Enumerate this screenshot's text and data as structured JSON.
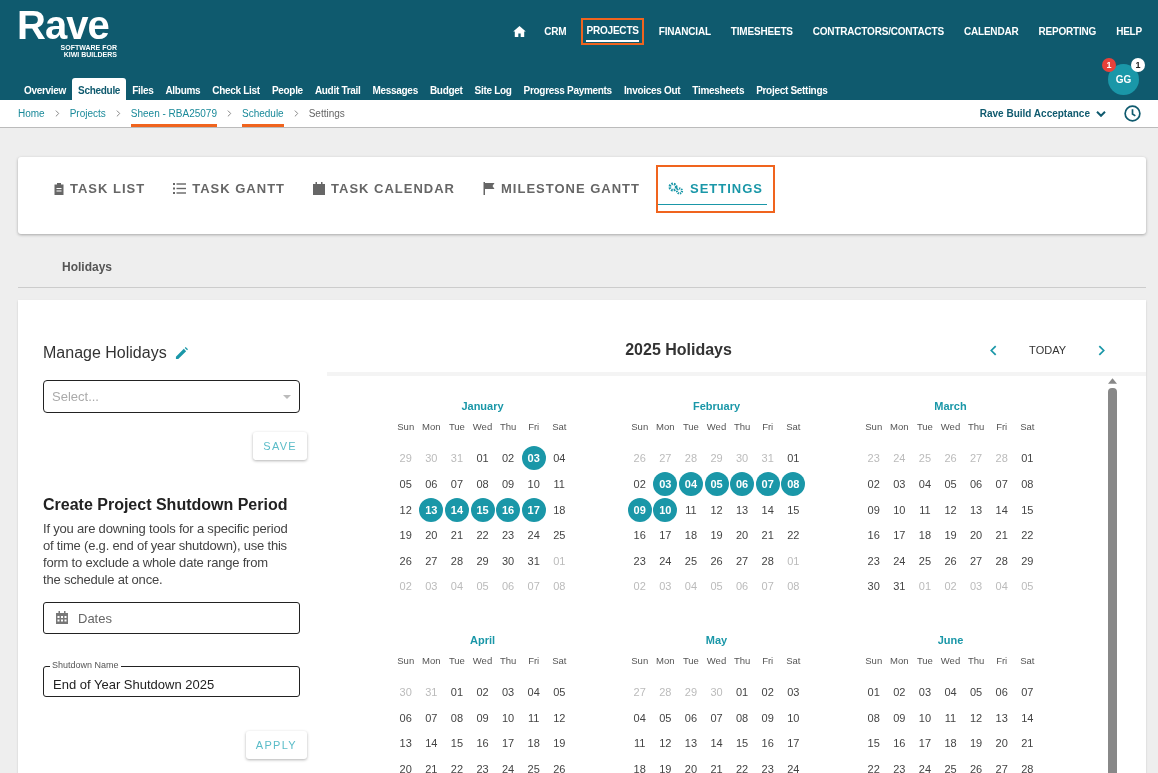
{
  "logo": {
    "name": "Rave",
    "tagline_lines": [
      "SOFTWARE FOR",
      "KIWI BUILDERS"
    ]
  },
  "main_nav": [
    {
      "label": "CRM",
      "selected": false,
      "highlighted": false
    },
    {
      "label": "PROJECTS",
      "selected": true,
      "highlighted": true
    },
    {
      "label": "FINANCIAL",
      "selected": false,
      "highlighted": false
    },
    {
      "label": "TIMESHEETS",
      "selected": false,
      "highlighted": false
    },
    {
      "label": "CONTRACTORS/CONTACTS",
      "selected": false,
      "highlighted": false
    },
    {
      "label": "CALENDAR",
      "selected": false,
      "highlighted": false
    },
    {
      "label": "REPORTING",
      "selected": false,
      "highlighted": false
    },
    {
      "label": "HELP",
      "selected": false,
      "highlighted": false
    }
  ],
  "project_nav": [
    {
      "label": "Overview",
      "selected": false
    },
    {
      "label": "Schedule",
      "selected": true
    },
    {
      "label": "Files",
      "selected": false
    },
    {
      "label": "Albums",
      "selected": false
    },
    {
      "label": "Check List",
      "selected": false
    },
    {
      "label": "People",
      "selected": false
    },
    {
      "label": "Audit Trail",
      "selected": false
    },
    {
      "label": "Messages",
      "selected": false
    },
    {
      "label": "Budget",
      "selected": false
    },
    {
      "label": "Site Log",
      "selected": false
    },
    {
      "label": "Progress Payments",
      "selected": false
    },
    {
      "label": "Invoices Out",
      "selected": false
    },
    {
      "label": "Timesheets",
      "selected": false
    },
    {
      "label": "Project Settings",
      "selected": false
    }
  ],
  "user": {
    "initials": "GG",
    "alert_count": "1",
    "message_count": "1"
  },
  "breadcrumbs": [
    {
      "label": "Home",
      "current": false,
      "highlighted": false
    },
    {
      "label": "Projects",
      "current": false,
      "highlighted": false
    },
    {
      "label": "Sheen - RBA25079",
      "current": false,
      "highlighted": true
    },
    {
      "label": "Schedule",
      "current": false,
      "highlighted": true
    },
    {
      "label": "Settings",
      "current": true,
      "highlighted": false
    }
  ],
  "company": "Rave Build Acceptance",
  "schedule_tabs": [
    {
      "label": "TASK LIST",
      "selected": false,
      "highlighted": false
    },
    {
      "label": "TASK GANTT",
      "selected": false,
      "highlighted": false
    },
    {
      "label": "TASK CALENDAR",
      "selected": false,
      "highlighted": false
    },
    {
      "label": "MILESTONE GANTT",
      "selected": false,
      "highlighted": false
    },
    {
      "label": "SETTINGS",
      "selected": true,
      "highlighted": true
    }
  ],
  "section_tab": "Holidays",
  "manage": {
    "title": "Manage Holidays",
    "select_placeholder": "Select...",
    "save": "SAVE"
  },
  "shutdown": {
    "title": "Create Project Shutdown Period",
    "description": "If you are downing tools for a specific period of time (e.g. end of year shutdown), use this form to exclude a whole date range from the schedule at once.",
    "dates_placeholder": "Dates",
    "name_label": "Shutdown Name",
    "name_value": "End of Year Shutdown 2025",
    "apply": "APPLY"
  },
  "calendar": {
    "title": "2025 Holidays",
    "today": "TODAY",
    "months": [
      {
        "name": "January",
        "weekdays": [
          "Sun",
          "Mon",
          "Tue",
          "Wed",
          "Thu",
          "Fri",
          "Sat"
        ],
        "weeks": [
          [
            {
              "day": "29",
              "outside": true,
              "holiday": false
            },
            {
              "day": "30",
              "outside": true,
              "holiday": false
            },
            {
              "day": "31",
              "outside": true,
              "holiday": false
            },
            {
              "day": "01",
              "outside": false,
              "holiday": false
            },
            {
              "day": "02",
              "outside": false,
              "holiday": false
            },
            {
              "day": "03",
              "outside": false,
              "holiday": true
            },
            {
              "day": "04",
              "outside": false,
              "holiday": false
            }
          ],
          [
            {
              "day": "05",
              "outside": false,
              "holiday": false
            },
            {
              "day": "06",
              "outside": false,
              "holiday": false
            },
            {
              "day": "07",
              "outside": false,
              "holiday": false
            },
            {
              "day": "08",
              "outside": false,
              "holiday": false
            },
            {
              "day": "09",
              "outside": false,
              "holiday": false
            },
            {
              "day": "10",
              "outside": false,
              "holiday": false
            },
            {
              "day": "11",
              "outside": false,
              "holiday": false
            }
          ],
          [
            {
              "day": "12",
              "outside": false,
              "holiday": false
            },
            {
              "day": "13",
              "outside": false,
              "holiday": true
            },
            {
              "day": "14",
              "outside": false,
              "holiday": true
            },
            {
              "day": "15",
              "outside": false,
              "holiday": true
            },
            {
              "day": "16",
              "outside": false,
              "holiday": true
            },
            {
              "day": "17",
              "outside": false,
              "holiday": true
            },
            {
              "day": "18",
              "outside": false,
              "holiday": false
            }
          ],
          [
            {
              "day": "19",
              "outside": false,
              "holiday": false
            },
            {
              "day": "20",
              "outside": false,
              "holiday": false
            },
            {
              "day": "21",
              "outside": false,
              "holiday": false
            },
            {
              "day": "22",
              "outside": false,
              "holiday": false
            },
            {
              "day": "23",
              "outside": false,
              "holiday": false
            },
            {
              "day": "24",
              "outside": false,
              "holiday": false
            },
            {
              "day": "25",
              "outside": false,
              "holiday": false
            }
          ],
          [
            {
              "day": "26",
              "outside": false,
              "holiday": false
            },
            {
              "day": "27",
              "outside": false,
              "holiday": false
            },
            {
              "day": "28",
              "outside": false,
              "holiday": false
            },
            {
              "day": "29",
              "outside": false,
              "holiday": false
            },
            {
              "day": "30",
              "outside": false,
              "holiday": false
            },
            {
              "day": "31",
              "outside": false,
              "holiday": false
            },
            {
              "day": "01",
              "outside": true,
              "holiday": false
            }
          ],
          [
            {
              "day": "02",
              "outside": true,
              "holiday": false
            },
            {
              "day": "03",
              "outside": true,
              "holiday": false
            },
            {
              "day": "04",
              "outside": true,
              "holiday": false
            },
            {
              "day": "05",
              "outside": true,
              "holiday": false
            },
            {
              "day": "06",
              "outside": true,
              "holiday": false
            },
            {
              "day": "07",
              "outside": true,
              "holiday": false
            },
            {
              "day": "08",
              "outside": true,
              "holiday": false
            }
          ]
        ]
      },
      {
        "name": "February",
        "weekdays": [
          "Sun",
          "Mon",
          "Tue",
          "Wed",
          "Thu",
          "Fri",
          "Sat"
        ],
        "weeks": [
          [
            {
              "day": "26",
              "outside": true,
              "holiday": false
            },
            {
              "day": "27",
              "outside": true,
              "holiday": false
            },
            {
              "day": "28",
              "outside": true,
              "holiday": false
            },
            {
              "day": "29",
              "outside": true,
              "holiday": false
            },
            {
              "day": "30",
              "outside": true,
              "holiday": false
            },
            {
              "day": "31",
              "outside": true,
              "holiday": false
            },
            {
              "day": "01",
              "outside": false,
              "holiday": false
            }
          ],
          [
            {
              "day": "02",
              "outside": false,
              "holiday": false
            },
            {
              "day": "03",
              "outside": false,
              "holiday": true
            },
            {
              "day": "04",
              "outside": false,
              "holiday": true
            },
            {
              "day": "05",
              "outside": false,
              "holiday": true
            },
            {
              "day": "06",
              "outside": false,
              "holiday": true
            },
            {
              "day": "07",
              "outside": false,
              "holiday": true
            },
            {
              "day": "08",
              "outside": false,
              "holiday": true
            }
          ],
          [
            {
              "day": "09",
              "outside": false,
              "holiday": true
            },
            {
              "day": "10",
              "outside": false,
              "holiday": true
            },
            {
              "day": "11",
              "outside": false,
              "holiday": false
            },
            {
              "day": "12",
              "outside": false,
              "holiday": false
            },
            {
              "day": "13",
              "outside": false,
              "holiday": false
            },
            {
              "day": "14",
              "outside": false,
              "holiday": false
            },
            {
              "day": "15",
              "outside": false,
              "holiday": false
            }
          ],
          [
            {
              "day": "16",
              "outside": false,
              "holiday": false
            },
            {
              "day": "17",
              "outside": false,
              "holiday": false
            },
            {
              "day": "18",
              "outside": false,
              "holiday": false
            },
            {
              "day": "19",
              "outside": false,
              "holiday": false
            },
            {
              "day": "20",
              "outside": false,
              "holiday": false
            },
            {
              "day": "21",
              "outside": false,
              "holiday": false
            },
            {
              "day": "22",
              "outside": false,
              "holiday": false
            }
          ],
          [
            {
              "day": "23",
              "outside": false,
              "holiday": false
            },
            {
              "day": "24",
              "outside": false,
              "holiday": false
            },
            {
              "day": "25",
              "outside": false,
              "holiday": false
            },
            {
              "day": "26",
              "outside": false,
              "holiday": false
            },
            {
              "day": "27",
              "outside": false,
              "holiday": false
            },
            {
              "day": "28",
              "outside": false,
              "holiday": false
            },
            {
              "day": "01",
              "outside": true,
              "holiday": false
            }
          ],
          [
            {
              "day": "02",
              "outside": true,
              "holiday": false
            },
            {
              "day": "03",
              "outside": true,
              "holiday": false
            },
            {
              "day": "04",
              "outside": true,
              "holiday": false
            },
            {
              "day": "05",
              "outside": true,
              "holiday": false
            },
            {
              "day": "06",
              "outside": true,
              "holiday": false
            },
            {
              "day": "07",
              "outside": true,
              "holiday": false
            },
            {
              "day": "08",
              "outside": true,
              "holiday": false
            }
          ]
        ]
      },
      {
        "name": "March",
        "weekdays": [
          "Sun",
          "Mon",
          "Tue",
          "Wed",
          "Thu",
          "Fri",
          "Sat"
        ],
        "weeks": [
          [
            {
              "day": "23",
              "outside": true,
              "holiday": false
            },
            {
              "day": "24",
              "outside": true,
              "holiday": false
            },
            {
              "day": "25",
              "outside": true,
              "holiday": false
            },
            {
              "day": "26",
              "outside": true,
              "holiday": false
            },
            {
              "day": "27",
              "outside": true,
              "holiday": false
            },
            {
              "day": "28",
              "outside": true,
              "holiday": false
            },
            {
              "day": "01",
              "outside": false,
              "holiday": false
            }
          ],
          [
            {
              "day": "02",
              "outside": false,
              "holiday": false
            },
            {
              "day": "03",
              "outside": false,
              "holiday": false
            },
            {
              "day": "04",
              "outside": false,
              "holiday": false
            },
            {
              "day": "05",
              "outside": false,
              "holiday": false
            },
            {
              "day": "06",
              "outside": false,
              "holiday": false
            },
            {
              "day": "07",
              "outside": false,
              "holiday": false
            },
            {
              "day": "08",
              "outside": false,
              "holiday": false
            }
          ],
          [
            {
              "day": "09",
              "outside": false,
              "holiday": false
            },
            {
              "day": "10",
              "outside": false,
              "holiday": false
            },
            {
              "day": "11",
              "outside": false,
              "holiday": false
            },
            {
              "day": "12",
              "outside": false,
              "holiday": false
            },
            {
              "day": "13",
              "outside": false,
              "holiday": false
            },
            {
              "day": "14",
              "outside": false,
              "holiday": false
            },
            {
              "day": "15",
              "outside": false,
              "holiday": false
            }
          ],
          [
            {
              "day": "16",
              "outside": false,
              "holiday": false
            },
            {
              "day": "17",
              "outside": false,
              "holiday": false
            },
            {
              "day": "18",
              "outside": false,
              "holiday": false
            },
            {
              "day": "19",
              "outside": false,
              "holiday": false
            },
            {
              "day": "20",
              "outside": false,
              "holiday": false
            },
            {
              "day": "21",
              "outside": false,
              "holiday": false
            },
            {
              "day": "22",
              "outside": false,
              "holiday": false
            }
          ],
          [
            {
              "day": "23",
              "outside": false,
              "holiday": false
            },
            {
              "day": "24",
              "outside": false,
              "holiday": false
            },
            {
              "day": "25",
              "outside": false,
              "holiday": false
            },
            {
              "day": "26",
              "outside": false,
              "holiday": false
            },
            {
              "day": "27",
              "outside": false,
              "holiday": false
            },
            {
              "day": "28",
              "outside": false,
              "holiday": false
            },
            {
              "day": "29",
              "outside": false,
              "holiday": false
            }
          ],
          [
            {
              "day": "30",
              "outside": false,
              "holiday": false
            },
            {
              "day": "31",
              "outside": false,
              "holiday": false
            },
            {
              "day": "01",
              "outside": true,
              "holiday": false
            },
            {
              "day": "02",
              "outside": true,
              "holiday": false
            },
            {
              "day": "03",
              "outside": true,
              "holiday": false
            },
            {
              "day": "04",
              "outside": true,
              "holiday": false
            },
            {
              "day": "05",
              "outside": true,
              "holiday": false
            }
          ]
        ]
      },
      {
        "name": "April",
        "weekdays": [
          "Sun",
          "Mon",
          "Tue",
          "Wed",
          "Thu",
          "Fri",
          "Sat"
        ],
        "weeks": [
          [
            {
              "day": "30",
              "outside": true,
              "holiday": false
            },
            {
              "day": "31",
              "outside": true,
              "holiday": false
            },
            {
              "day": "01",
              "outside": false,
              "holiday": false
            },
            {
              "day": "02",
              "outside": false,
              "holiday": false
            },
            {
              "day": "03",
              "outside": false,
              "holiday": false
            },
            {
              "day": "04",
              "outside": false,
              "holiday": false
            },
            {
              "day": "05",
              "outside": false,
              "holiday": false
            }
          ],
          [
            {
              "day": "06",
              "outside": false,
              "holiday": false
            },
            {
              "day": "07",
              "outside": false,
              "holiday": false
            },
            {
              "day": "08",
              "outside": false,
              "holiday": false
            },
            {
              "day": "09",
              "outside": false,
              "holiday": false
            },
            {
              "day": "10",
              "outside": false,
              "holiday": false
            },
            {
              "day": "11",
              "outside": false,
              "holiday": false
            },
            {
              "day": "12",
              "outside": false,
              "holiday": false
            }
          ],
          [
            {
              "day": "13",
              "outside": false,
              "holiday": false
            },
            {
              "day": "14",
              "outside": false,
              "holiday": false
            },
            {
              "day": "15",
              "outside": false,
              "holiday": false
            },
            {
              "day": "16",
              "outside": false,
              "holiday": false
            },
            {
              "day": "17",
              "outside": false,
              "holiday": false
            },
            {
              "day": "18",
              "outside": false,
              "holiday": false
            },
            {
              "day": "19",
              "outside": false,
              "holiday": false
            }
          ],
          [
            {
              "day": "20",
              "outside": false,
              "holiday": false
            },
            {
              "day": "21",
              "outside": false,
              "holiday": false
            },
            {
              "day": "22",
              "outside": false,
              "holiday": false
            },
            {
              "day": "23",
              "outside": false,
              "holiday": false
            },
            {
              "day": "24",
              "outside": false,
              "holiday": false
            },
            {
              "day": "25",
              "outside": false,
              "holiday": false
            },
            {
              "day": "26",
              "outside": false,
              "holiday": false
            }
          ]
        ]
      },
      {
        "name": "May",
        "weekdays": [
          "Sun",
          "Mon",
          "Tue",
          "Wed",
          "Thu",
          "Fri",
          "Sat"
        ],
        "weeks": [
          [
            {
              "day": "27",
              "outside": true,
              "holiday": false
            },
            {
              "day": "28",
              "outside": true,
              "holiday": false
            },
            {
              "day": "29",
              "outside": true,
              "holiday": false
            },
            {
              "day": "30",
              "outside": true,
              "holiday": false
            },
            {
              "day": "01",
              "outside": false,
              "holiday": false
            },
            {
              "day": "02",
              "outside": false,
              "holiday": false
            },
            {
              "day": "03",
              "outside": false,
              "holiday": false
            }
          ],
          [
            {
              "day": "04",
              "outside": false,
              "holiday": false
            },
            {
              "day": "05",
              "outside": false,
              "holiday": false
            },
            {
              "day": "06",
              "outside": false,
              "holiday": false
            },
            {
              "day": "07",
              "outside": false,
              "holiday": false
            },
            {
              "day": "08",
              "outside": false,
              "holiday": false
            },
            {
              "day": "09",
              "outside": false,
              "holiday": false
            },
            {
              "day": "10",
              "outside": false,
              "holiday": false
            }
          ],
          [
            {
              "day": "11",
              "outside": false,
              "holiday": false
            },
            {
              "day": "12",
              "outside": false,
              "holiday": false
            },
            {
              "day": "13",
              "outside": false,
              "holiday": false
            },
            {
              "day": "14",
              "outside": false,
              "holiday": false
            },
            {
              "day": "15",
              "outside": false,
              "holiday": false
            },
            {
              "day": "16",
              "outside": false,
              "holiday": false
            },
            {
              "day": "17",
              "outside": false,
              "holiday": false
            }
          ],
          [
            {
              "day": "18",
              "outside": false,
              "holiday": false
            },
            {
              "day": "19",
              "outside": false,
              "holiday": false
            },
            {
              "day": "20",
              "outside": false,
              "holiday": false
            },
            {
              "day": "21",
              "outside": false,
              "holiday": false
            },
            {
              "day": "22",
              "outside": false,
              "holiday": false
            },
            {
              "day": "23",
              "outside": false,
              "holiday": false
            },
            {
              "day": "24",
              "outside": false,
              "holiday": false
            }
          ]
        ]
      },
      {
        "name": "June",
        "weekdays": [
          "Sun",
          "Mon",
          "Tue",
          "Wed",
          "Thu",
          "Fri",
          "Sat"
        ],
        "weeks": [
          [
            {
              "day": "01",
              "outside": false,
              "holiday": false
            },
            {
              "day": "02",
              "outside": false,
              "holiday": false
            },
            {
              "day": "03",
              "outside": false,
              "holiday": false
            },
            {
              "day": "04",
              "outside": false,
              "holiday": false
            },
            {
              "day": "05",
              "outside": false,
              "holiday": false
            },
            {
              "day": "06",
              "outside": false,
              "holiday": false
            },
            {
              "day": "07",
              "outside": false,
              "holiday": false
            }
          ],
          [
            {
              "day": "08",
              "outside": false,
              "holiday": false
            },
            {
              "day": "09",
              "outside": false,
              "holiday": false
            },
            {
              "day": "10",
              "outside": false,
              "holiday": false
            },
            {
              "day": "11",
              "outside": false,
              "holiday": false
            },
            {
              "day": "12",
              "outside": false,
              "holiday": false
            },
            {
              "day": "13",
              "outside": false,
              "holiday": false
            },
            {
              "day": "14",
              "outside": false,
              "holiday": false
            }
          ],
          [
            {
              "day": "15",
              "outside": false,
              "holiday": false
            },
            {
              "day": "16",
              "outside": false,
              "holiday": false
            },
            {
              "day": "17",
              "outside": false,
              "holiday": false
            },
            {
              "day": "18",
              "outside": false,
              "holiday": false
            },
            {
              "day": "19",
              "outside": false,
              "holiday": false
            },
            {
              "day": "20",
              "outside": false,
              "holiday": false
            },
            {
              "day": "21",
              "outside": false,
              "holiday": false
            }
          ],
          [
            {
              "day": "22",
              "outside": false,
              "holiday": false
            },
            {
              "day": "23",
              "outside": false,
              "holiday": false
            },
            {
              "day": "24",
              "outside": false,
              "holiday": false
            },
            {
              "day": "25",
              "outside": false,
              "holiday": false
            },
            {
              "day": "26",
              "outside": false,
              "holiday": false
            },
            {
              "day": "27",
              "outside": false,
              "holiday": false
            },
            {
              "day": "28",
              "outside": false,
              "holiday": false
            }
          ]
        ]
      }
    ]
  }
}
